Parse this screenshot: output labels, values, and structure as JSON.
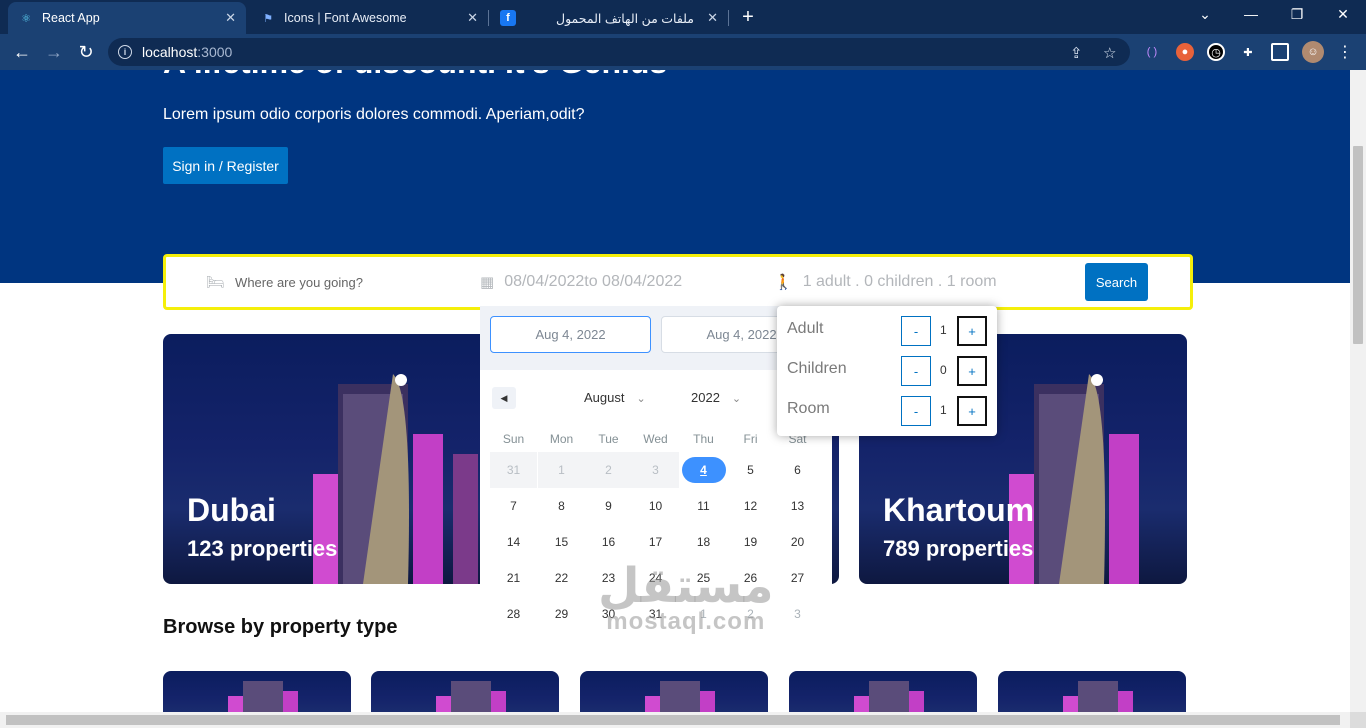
{
  "browser": {
    "tabs": [
      {
        "title": "React App",
        "icon": "react-icon"
      },
      {
        "title": "Icons | Font Awesome",
        "icon": "flag-icon"
      },
      {
        "title": "ملفات من الهاتف المحمول",
        "icon": "facebook-icon"
      }
    ],
    "url_host": "localhost",
    "url_port": ":3000"
  },
  "hero": {
    "title": "A lifetime of discount. It's Genius",
    "description": "Lorem ipsum odio corporis dolores commodi. Aperiam,odit?",
    "signin_label": "Sign in / Register"
  },
  "search": {
    "destination_placeholder": "Where are you going?",
    "dates_text": "08/04/2022to 08/04/2022",
    "options_text": "1 adult . 0 children . 1 room",
    "search_label": "Search"
  },
  "datepicker": {
    "start_input": "Aug 4, 2022",
    "end_input": "Aug 4, 2022",
    "month": "August",
    "year": "2022",
    "weekdays": [
      "Sun",
      "Mon",
      "Tue",
      "Wed",
      "Thu",
      "Fri",
      "Sat"
    ],
    "weeks": [
      [
        "31",
        "1",
        "2",
        "3",
        "4",
        "5",
        "6"
      ],
      [
        "7",
        "8",
        "9",
        "10",
        "11",
        "12",
        "13"
      ],
      [
        "14",
        "15",
        "16",
        "17",
        "18",
        "19",
        "20"
      ],
      [
        "21",
        "22",
        "23",
        "24",
        "25",
        "26",
        "27"
      ],
      [
        "28",
        "29",
        "30",
        "31",
        "1",
        "2",
        "3"
      ]
    ],
    "selected_day": "4"
  },
  "options": {
    "rows": [
      {
        "label": "Adult",
        "value": "1"
      },
      {
        "label": "Children",
        "value": "0"
      },
      {
        "label": "Room",
        "value": "1"
      }
    ],
    "minus_label": "-",
    "plus_label": "+"
  },
  "featured": [
    {
      "name": "Dubai",
      "properties": "123 properties"
    },
    {
      "name": "Khartoum",
      "properties": "789 properties"
    }
  ],
  "browse": {
    "title": "Browse by property type"
  },
  "watermark": {
    "arabic": "مستقل",
    "latin": "mostaql.com"
  },
  "colors": {
    "brand": "#003580",
    "button": "#0071c2",
    "search_border": "#f5ef0a",
    "selected_day": "#3d91ff"
  }
}
